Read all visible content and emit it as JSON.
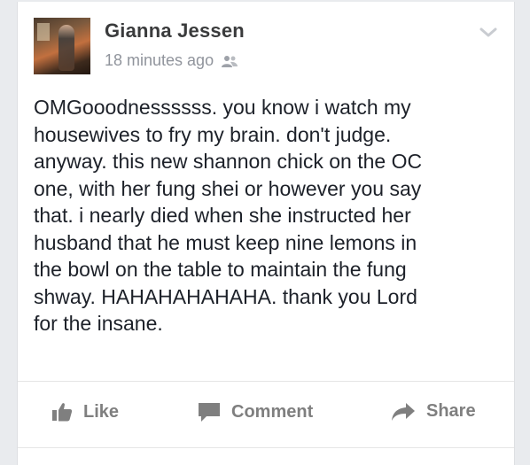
{
  "post": {
    "author": "Gianna Jessen",
    "timestamp": "18 minutes ago",
    "privacy_icon": "friends-icon",
    "text": "OMGooodnessssss. you know i watch my\nhousewives to fry my brain. don't judge.\nanyway. this new shannon chick on the OC\none, with her fung shei or however you say\nthat. i nearly died when she instructed her\nhusband that he must keep nine lemons in\nthe bowl on the table to maintain the fung\nshway. HAHAHAHAHAHA.  thank you Lord\nfor the insane."
  },
  "actions": {
    "like_label": "Like",
    "comment_label": "Comment",
    "share_label": "Share"
  },
  "colors": {
    "text": "#1d2129",
    "secondary": "#90949c",
    "action": "#7f7f7f"
  }
}
